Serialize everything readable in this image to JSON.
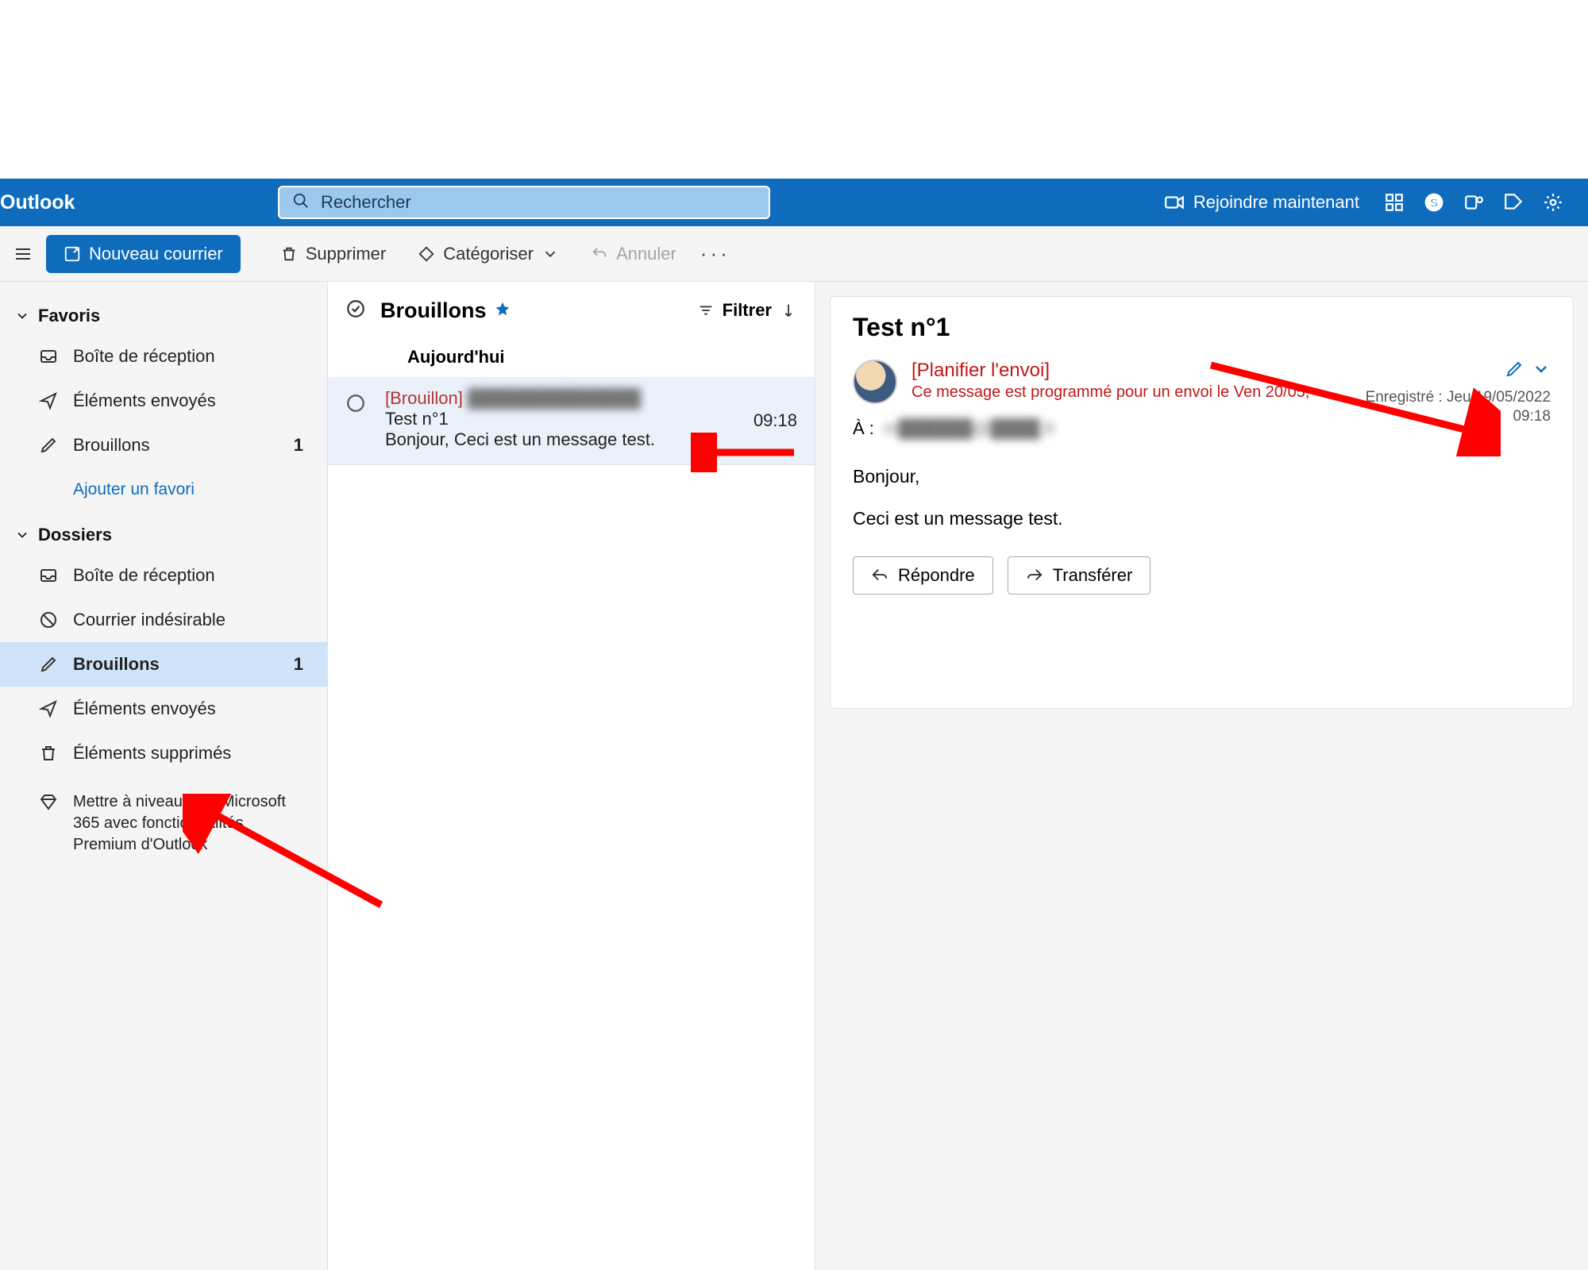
{
  "brand": "Outlook",
  "search": {
    "placeholder": "Rechercher"
  },
  "header": {
    "join": "Rejoindre maintenant"
  },
  "toolbar": {
    "new_mail": "Nouveau courrier",
    "delete": "Supprimer",
    "categorize": "Catégoriser",
    "undo": "Annuler"
  },
  "nav": {
    "favorites": "Favoris",
    "folders": "Dossiers",
    "inbox": "Boîte de réception",
    "sent": "Éléments envoyés",
    "drafts": "Brouillons",
    "drafts_count": "1",
    "add_fav": "Ajouter un favori",
    "junk": "Courrier indésirable",
    "deleted": "Éléments supprimés",
    "upgrade": "Mettre à niveau vers Microsoft 365 avec fonctionnalités Premium d'Outlook"
  },
  "list": {
    "folder_title": "Brouillons",
    "filter": "Filtrer",
    "group": "Aujourd'hui",
    "item": {
      "draft_tag": "[Brouillon]",
      "recipient_masked": "██████████████",
      "subject": "Test n°1",
      "preview": "Bonjour, Ceci est un message test.",
      "time": "09:18"
    }
  },
  "reader": {
    "subject": "Test n°1",
    "plan": "[Planifier l'envoi]",
    "schedule_note": "Ce message est programmé pour un envoi le Ven 20/05,",
    "saved_label": "Enregistré : Jeu 19/05/2022",
    "saved_time": "09:18",
    "to_label": "À :",
    "to_value_masked": "m██████@████.fr",
    "body_line1": "Bonjour,",
    "body_line2": "Ceci est un message test.",
    "reply": "Répondre",
    "forward": "Transférer"
  }
}
